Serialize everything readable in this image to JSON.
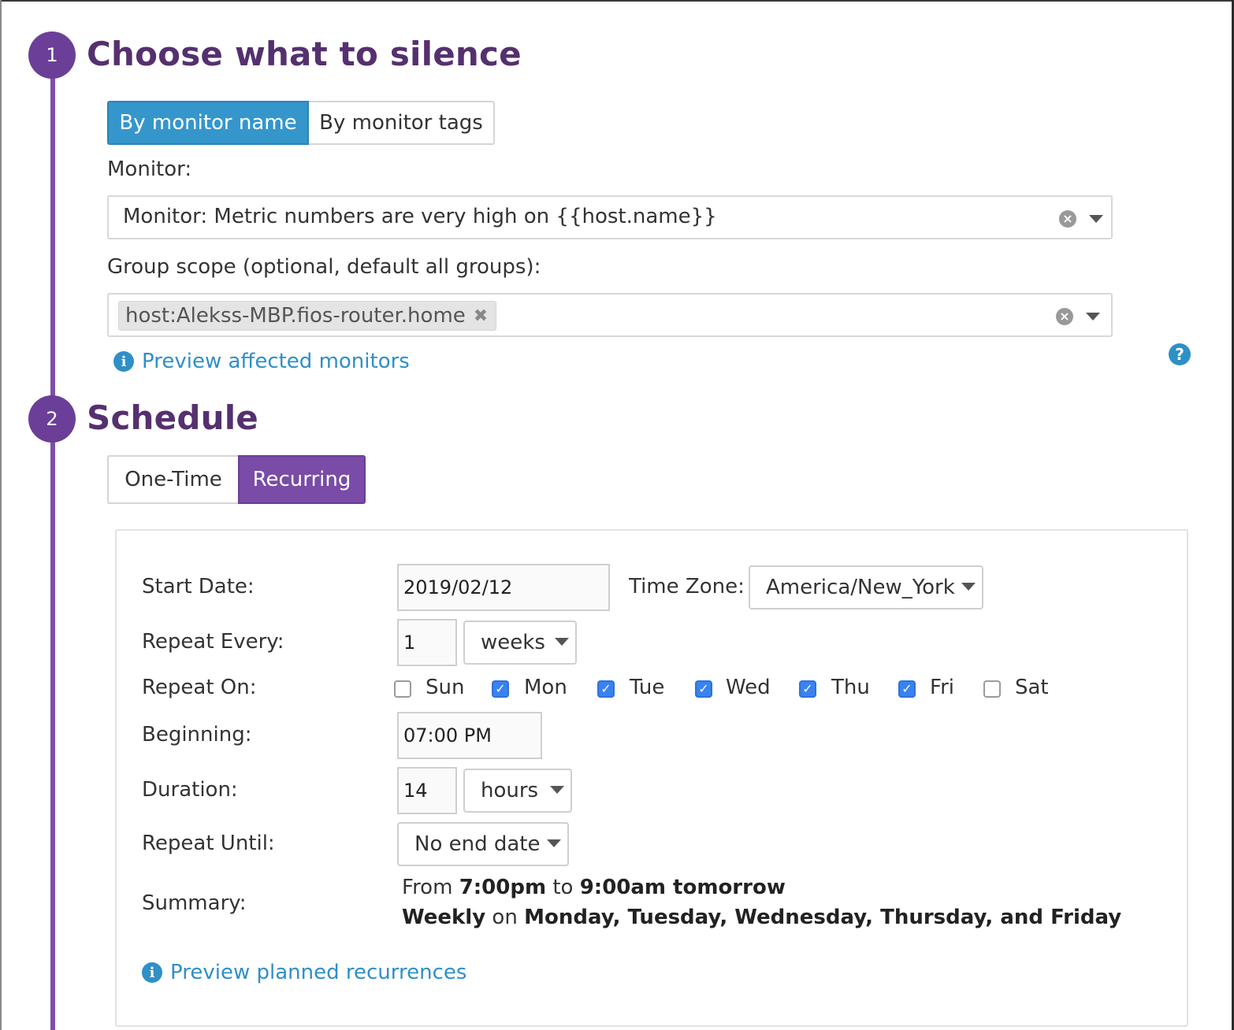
{
  "step1": {
    "number": "1",
    "title": "Choose what to silence",
    "tabs": [
      "By monitor name",
      "By monitor tags"
    ],
    "monitor_label": "Monitor:",
    "monitor_value": "Monitor: Metric numbers are very high on {{host.name}}",
    "scope_label": "Group scope (optional, default all groups):",
    "scope_tag": "host:Alekss-MBP.fios-router.home",
    "preview_link": "Preview affected monitors",
    "help_icon": "?"
  },
  "step2": {
    "number": "2",
    "title": "Schedule",
    "tabs": [
      "One-Time",
      "Recurring"
    ]
  },
  "form": {
    "start_date_label": "Start Date:",
    "start_date": "2019/02/12",
    "timezone_label": "Time Zone:",
    "timezone": "America/New_York",
    "repeat_every_label": "Repeat Every:",
    "repeat_every_value": "1",
    "repeat_every_unit": "weeks",
    "repeat_on_label": "Repeat On:",
    "days": [
      {
        "label": "Sun",
        "checked": false
      },
      {
        "label": "Mon",
        "checked": true
      },
      {
        "label": "Tue",
        "checked": true
      },
      {
        "label": "Wed",
        "checked": true
      },
      {
        "label": "Thu",
        "checked": true
      },
      {
        "label": "Fri",
        "checked": true
      },
      {
        "label": "Sat",
        "checked": false
      }
    ],
    "beginning_label": "Beginning:",
    "beginning_value": "07:00 PM",
    "duration_label": "Duration:",
    "duration_value": "14",
    "duration_unit": "hours",
    "repeat_until_label": "Repeat Until:",
    "repeat_until": "No end date",
    "summary_label": "Summary:",
    "summary": {
      "line1": {
        "from": "From ",
        "start": "7:00pm",
        "to": " to ",
        "end": "9:00am tomorrow"
      },
      "line2": {
        "freq": "Weekly",
        "on": " on ",
        "days": "Monday, Tuesday, Wednesday, Thursday, and Friday"
      }
    },
    "preview_link": "Preview planned recurrences"
  },
  "colors": {
    "step_purple": "#6b3f97",
    "title_purple": "#55306f",
    "active_blue": "#3596cc",
    "active_purple": "#7a4ba7",
    "link_blue": "#2f8fc7",
    "checkbox_blue": "#3a82f0"
  },
  "icons": {
    "clear": "clear-icon",
    "caret": "chevron-down-icon",
    "info": "info-icon",
    "help": "help-icon",
    "check": "check-icon",
    "tag_remove": "close-icon"
  }
}
